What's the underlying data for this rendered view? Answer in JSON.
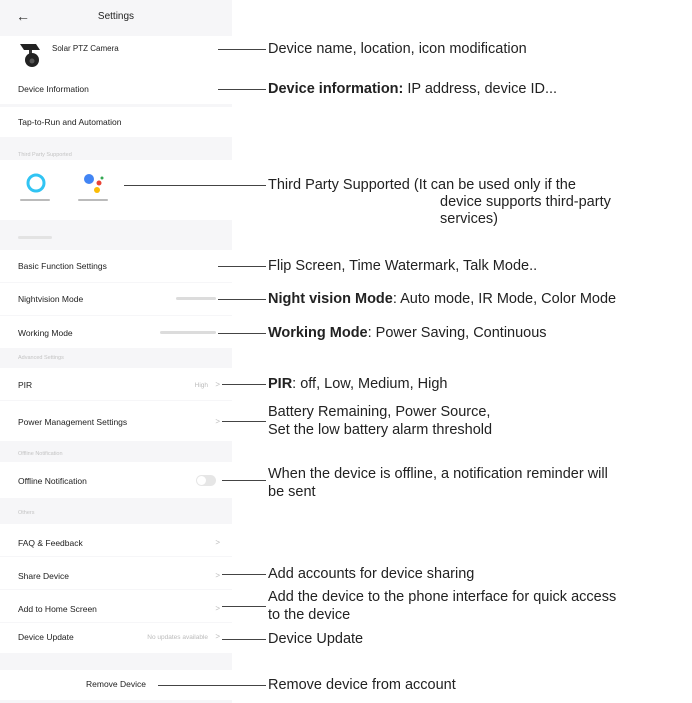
{
  "header": {
    "back_icon": "arrow-left-icon",
    "title": "Settings"
  },
  "device": {
    "name": "Solar PTZ Camera",
    "icon": "camera-icon"
  },
  "rows": {
    "device_information": "Device Information",
    "tap_to_run": "Tap-to-Run and Automation",
    "third_party_section": "Third Party Supported",
    "alexa_label": "amazon alexa",
    "google_label": "Google Home",
    "basic_function": "Basic Function Settings",
    "nightvision": "Nightvision Mode",
    "working_mode": "Working Mode",
    "advanced_section": "Advanced Settings",
    "pir": "PIR",
    "pir_value": "High",
    "power_management": "Power Management Settings",
    "offline_section": "Offline Notification",
    "offline_notification": "Offline Notification",
    "offline_toggle": "off",
    "others_section": "Others",
    "faq": "FAQ & Feedback",
    "share_device": "Share Device",
    "add_home": "Add to Home Screen",
    "device_update": "Device Update",
    "device_update_value": "No updates available",
    "remove_device": "Remove Device"
  },
  "chevron": ">",
  "annotations": {
    "device_name": "Device name, location, icon modification",
    "device_info_bold": "Device information:",
    "device_info_rest": " IP address, device ID...",
    "third_party_1": "Third Party Supported (It can be used only if the",
    "third_party_2": "device supports third-party",
    "third_party_3": "services)",
    "basic_function": "Flip Screen, Time Watermark, Talk Mode..",
    "night_bold": "Night vision Mode",
    "night_rest": ": Auto mode, IR Mode, Color Mode",
    "working_bold": "Working Mode",
    "working_rest": ": Power Saving, Continuous",
    "pir_bold": "PIR",
    "pir_rest": ": off, Low, Medium, High",
    "power_1": "Battery Remaining, Power Source,",
    "power_2": "Set the low battery alarm threshold",
    "offline_1": "When the device is offline, a notification reminder will",
    "offline_2": "be sent",
    "share": "Add accounts for device sharing",
    "add_home_1": "Add the device to the phone interface for quick access",
    "add_home_2": "to the device",
    "device_update": "Device Update",
    "remove": "Remove device from account"
  }
}
